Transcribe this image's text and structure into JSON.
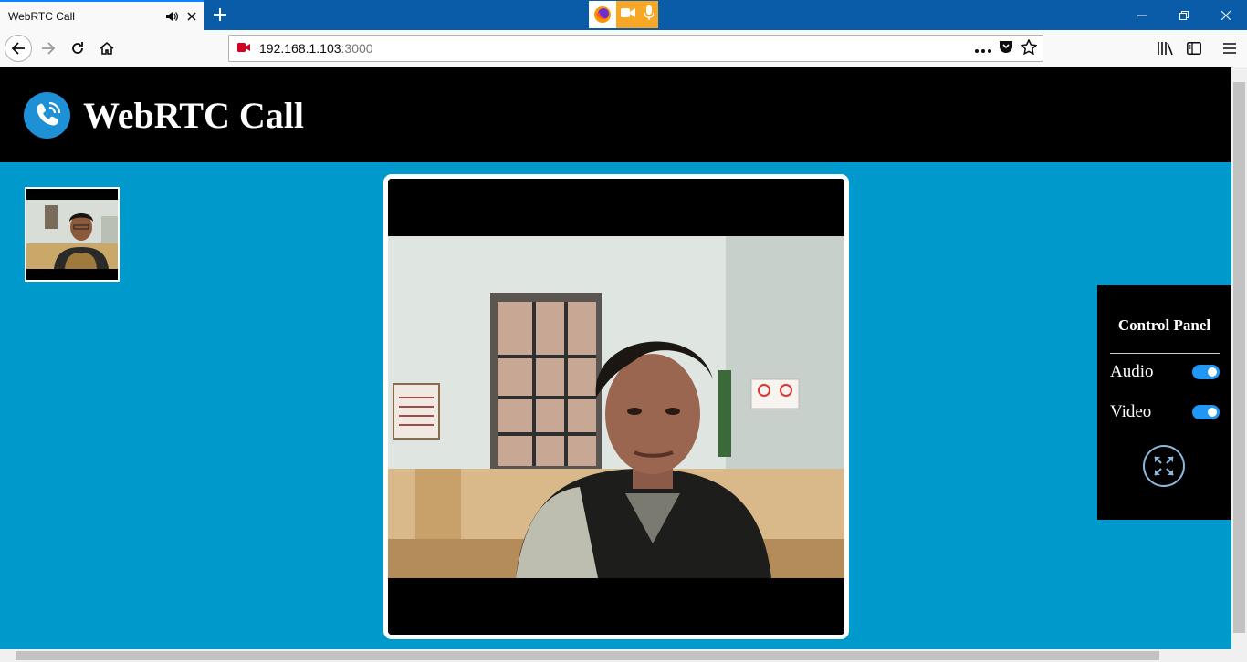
{
  "browser": {
    "tab_title": "WebRTC Call",
    "url_host": "192.168.1.103",
    "url_port": ":3000",
    "window_controls": [
      "minimize-icon",
      "restore-icon",
      "close-icon"
    ]
  },
  "header": {
    "title": "WebRTC Call",
    "logo_icon": "phone-call-icon"
  },
  "video": {
    "local_preview_icon": "local-camera-feed",
    "remote_feed_icon": "remote-camera-feed"
  },
  "control_panel": {
    "title": "Control Panel",
    "audio_label": "Audio",
    "audio_on": true,
    "video_label": "Video",
    "video_on": true,
    "fullscreen_icon": "expand-icon"
  },
  "colors": {
    "page_background": "#0099cc",
    "header_background": "#000000",
    "toggle_accent": "#2196f3",
    "logo_circle": "#1e90d6"
  }
}
